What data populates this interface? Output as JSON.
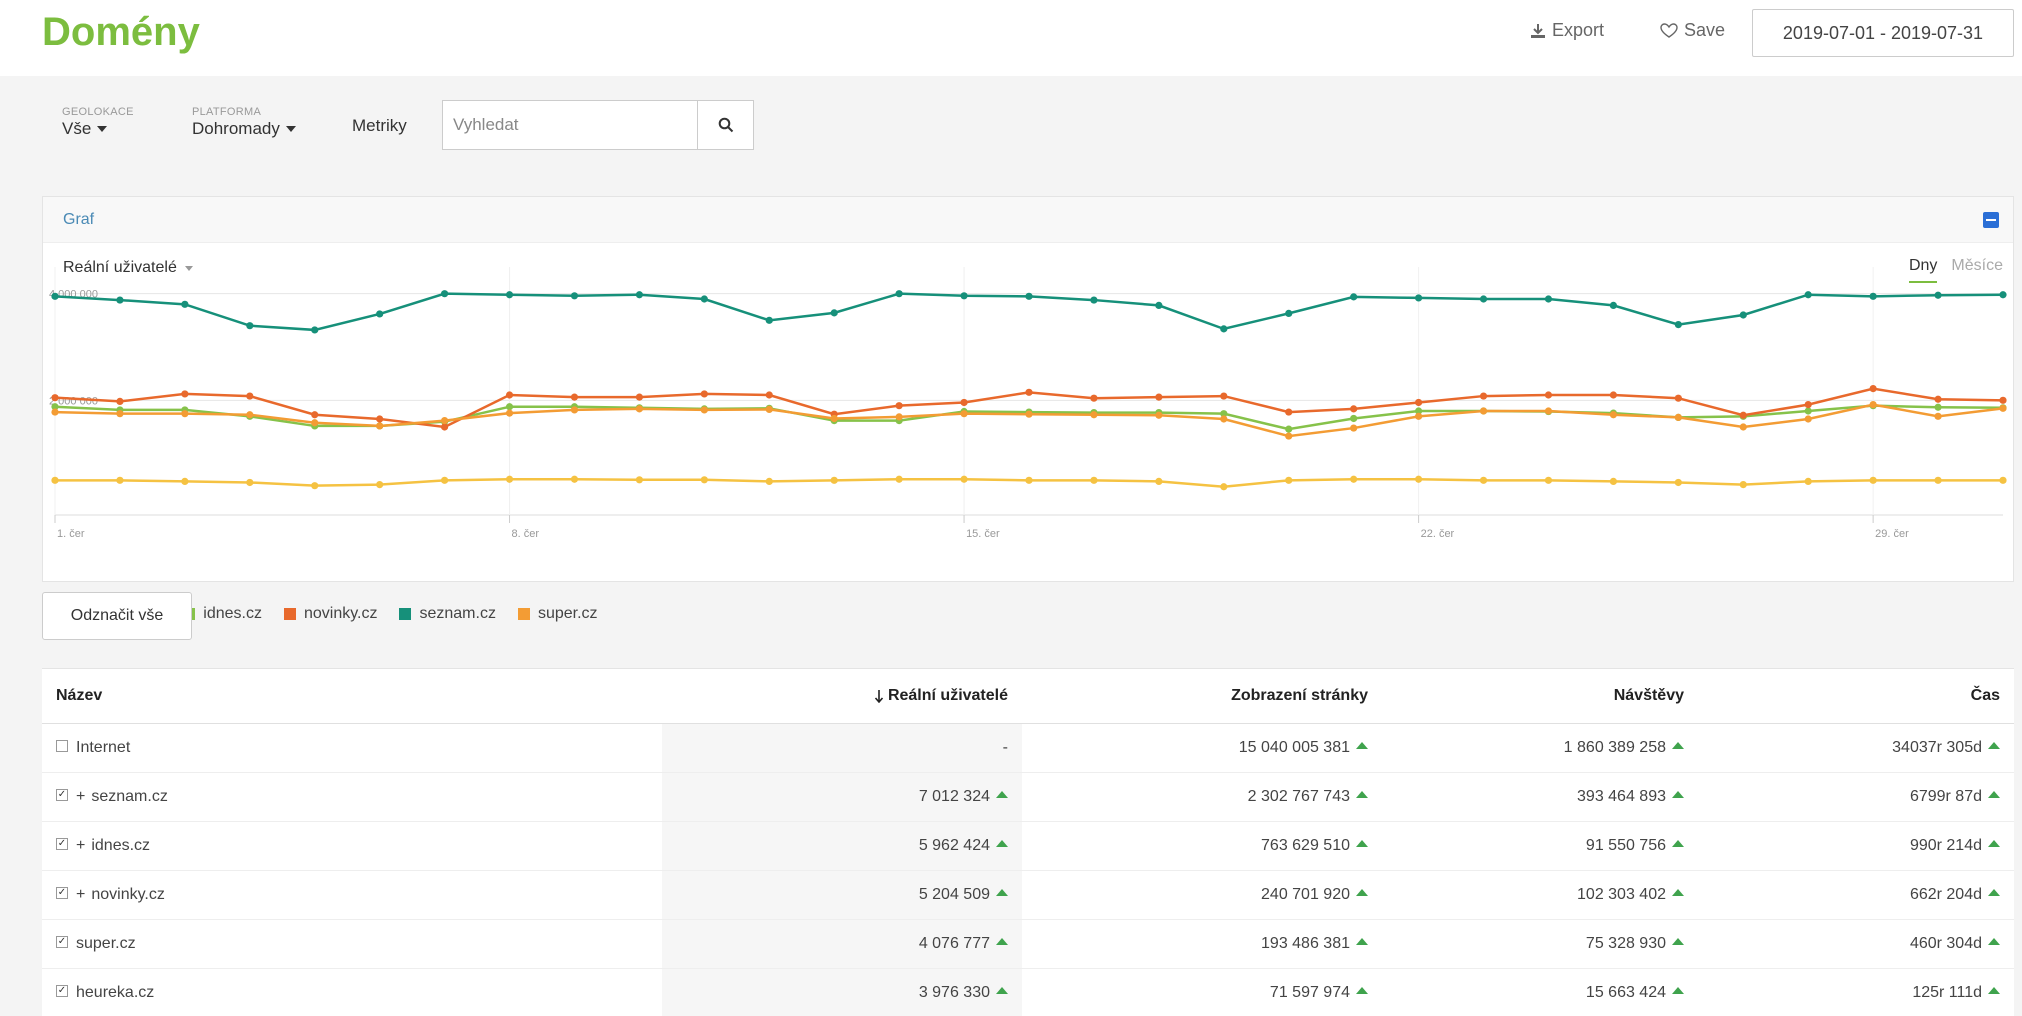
{
  "header": {
    "title": "Domény",
    "export_label": "Export",
    "save_label": "Save",
    "date_range": "2019-07-01 - 2019-07-31"
  },
  "filters": {
    "geo_label": "GEOLOKACE",
    "geo_value": "Vše",
    "platform_label": "PLATFORMA",
    "platform_value": "Dohromady",
    "metriky_label": "Metriky",
    "search_placeholder": "Vyhledat"
  },
  "graph": {
    "title": "Graf",
    "metric": "Reální uživatelé",
    "period_tabs": [
      "Dny",
      "Měsíce"
    ],
    "deselect_label": "Odznačit vše"
  },
  "chart_data": {
    "type": "line",
    "x": [
      1,
      2,
      3,
      4,
      5,
      6,
      7,
      8,
      9,
      10,
      11,
      12,
      13,
      14,
      15,
      16,
      17,
      18,
      19,
      20,
      21,
      22,
      23,
      24,
      25,
      26,
      27,
      28,
      29,
      30,
      31
    ],
    "x_tick_labels": [
      "1. čer",
      "8. čer",
      "15. čer",
      "22. čer",
      "29. čer"
    ],
    "y_tick_labels": [
      "4 000 000",
      "2 000 000"
    ],
    "ylim": [
      0,
      4500000
    ],
    "colors": {
      "heureka.cz": "#f5c242",
      "idnes.cz": "#86c24a",
      "novinky.cz": "#e8692c",
      "seznam.cz": "#16907a",
      "super.cz": "#f39c34"
    },
    "series": [
      {
        "name": "heureka.cz",
        "values": [
          500000,
          500000,
          480000,
          460000,
          400000,
          420000,
          500000,
          520000,
          520000,
          510000,
          510000,
          480000,
          500000,
          520000,
          520000,
          500000,
          500000,
          480000,
          380000,
          500000,
          520000,
          520000,
          500000,
          500000,
          480000,
          460000,
          420000,
          480000,
          500000,
          500000,
          500000
        ]
      },
      {
        "name": "idnes.cz",
        "values": [
          1880000,
          1820000,
          1820000,
          1700000,
          1520000,
          1520000,
          1600000,
          1880000,
          1880000,
          1860000,
          1840000,
          1850000,
          1620000,
          1620000,
          1790000,
          1780000,
          1770000,
          1770000,
          1750000,
          1460000,
          1660000,
          1800000,
          1800000,
          1790000,
          1760000,
          1680000,
          1700000,
          1800000,
          1900000,
          1870000,
          1860000
        ]
      },
      {
        "name": "novinky.cz",
        "values": [
          2050000,
          1980000,
          2120000,
          2080000,
          1730000,
          1650000,
          1500000,
          2100000,
          2060000,
          2060000,
          2120000,
          2100000,
          1740000,
          1900000,
          1960000,
          2150000,
          2040000,
          2060000,
          2080000,
          1780000,
          1840000,
          1960000,
          2080000,
          2100000,
          2100000,
          2040000,
          1720000,
          1920000,
          2220000,
          2020000,
          2000000
        ]
      },
      {
        "name": "seznam.cz",
        "values": [
          3950000,
          3880000,
          3800000,
          3400000,
          3320000,
          3620000,
          4000000,
          3980000,
          3960000,
          3980000,
          3900000,
          3500000,
          3640000,
          4000000,
          3960000,
          3950000,
          3880000,
          3780000,
          3340000,
          3630000,
          3940000,
          3920000,
          3900000,
          3900000,
          3780000,
          3420000,
          3600000,
          3980000,
          3950000,
          3970000,
          3980000
        ]
      },
      {
        "name": "super.cz",
        "values": [
          1780000,
          1750000,
          1750000,
          1730000,
          1580000,
          1520000,
          1620000,
          1760000,
          1820000,
          1840000,
          1820000,
          1830000,
          1660000,
          1690000,
          1750000,
          1740000,
          1730000,
          1720000,
          1650000,
          1330000,
          1480000,
          1700000,
          1800000,
          1800000,
          1730000,
          1680000,
          1500000,
          1650000,
          1920000,
          1700000,
          1850000
        ]
      }
    ]
  },
  "table": {
    "headers": {
      "name": "Název",
      "users": "Reální uživatelé",
      "views": "Zobrazení stránky",
      "visits": "Návštěvy",
      "time": "Čas"
    },
    "rows": [
      {
        "name": "Internet",
        "users": "-",
        "views": "15 040 005 381",
        "visits": "1 860 389 258",
        "time": "34037r 305d",
        "checked": false,
        "expandable": false
      },
      {
        "name": "seznam.cz",
        "users": "7 012 324",
        "views": "2 302 767 743",
        "visits": "393 464 893",
        "time": "6799r 87d",
        "checked": true,
        "expandable": true
      },
      {
        "name": "idnes.cz",
        "users": "5 962 424",
        "views": "763 629 510",
        "visits": "91 550 756",
        "time": "990r 214d",
        "checked": true,
        "expandable": true
      },
      {
        "name": "novinky.cz",
        "users": "5 204 509",
        "views": "240 701 920",
        "visits": "102 303 402",
        "time": "662r 204d",
        "checked": true,
        "expandable": true
      },
      {
        "name": "super.cz",
        "users": "4 076 777",
        "views": "193 486 381",
        "visits": "75 328 930",
        "time": "460r 304d",
        "checked": true,
        "expandable": false
      },
      {
        "name": "heureka.cz",
        "users": "3 976 330",
        "views": "71 597 974",
        "visits": "15 663 424",
        "time": "125r 111d",
        "checked": true,
        "expandable": false
      }
    ]
  }
}
